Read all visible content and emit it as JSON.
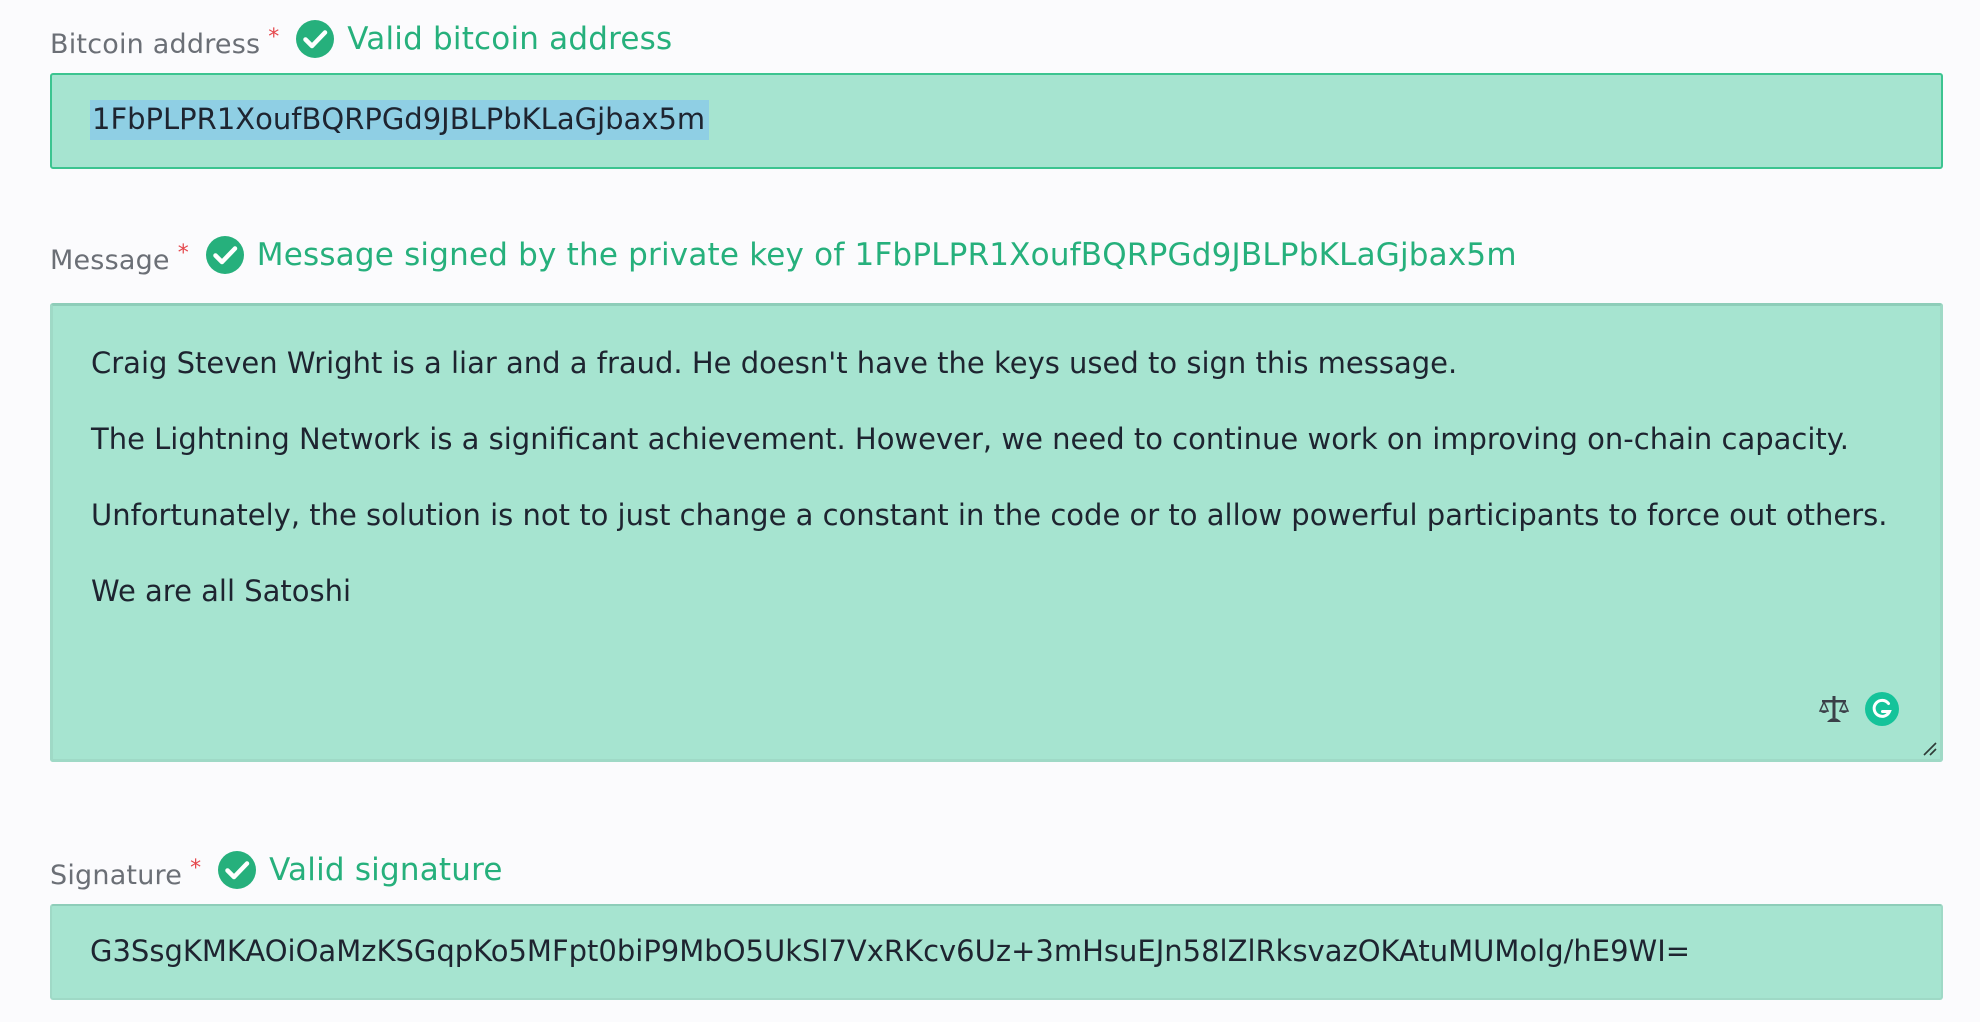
{
  "address": {
    "label": "Bitcoin address",
    "required_mark": "*",
    "status": "Valid bitcoin address",
    "value": "1FbPLPR1XoufBQRPGd9JBLPbKLaGjbax5m"
  },
  "message": {
    "label": "Message",
    "required_mark": "*",
    "status": "Message signed by the private key of 1FbPLPR1XoufBQRPGd9JBLPbKLaGjbax5m",
    "lines": [
      "Craig Steven Wright is a liar and a fraud. He doesn't have the keys used to sign this message.",
      "The Lightning Network is a significant achievement. However, we need to continue work on improving on-chain capacity.",
      "Unfortunately, the solution is not to just change a constant in the code or to allow powerful participants to force out others.",
      "We are all Satoshi"
    ],
    "tool_icons": [
      "scale-icon",
      "grammarly-icon"
    ]
  },
  "signature": {
    "label": "Signature",
    "required_mark": "*",
    "status": "Valid signature",
    "value": "G3SsgKMKAOiOaMzKSGqpKo5MFpt0biP9MbO5UkSl7VxRKcv6Uz+3mHsuEJn58lZlRksvazOKAtuMUMolg/hE9WI="
  },
  "colors": {
    "valid_green": "#26b07c",
    "field_fill": "#a6e4d0",
    "required_red": "#e5484d"
  }
}
